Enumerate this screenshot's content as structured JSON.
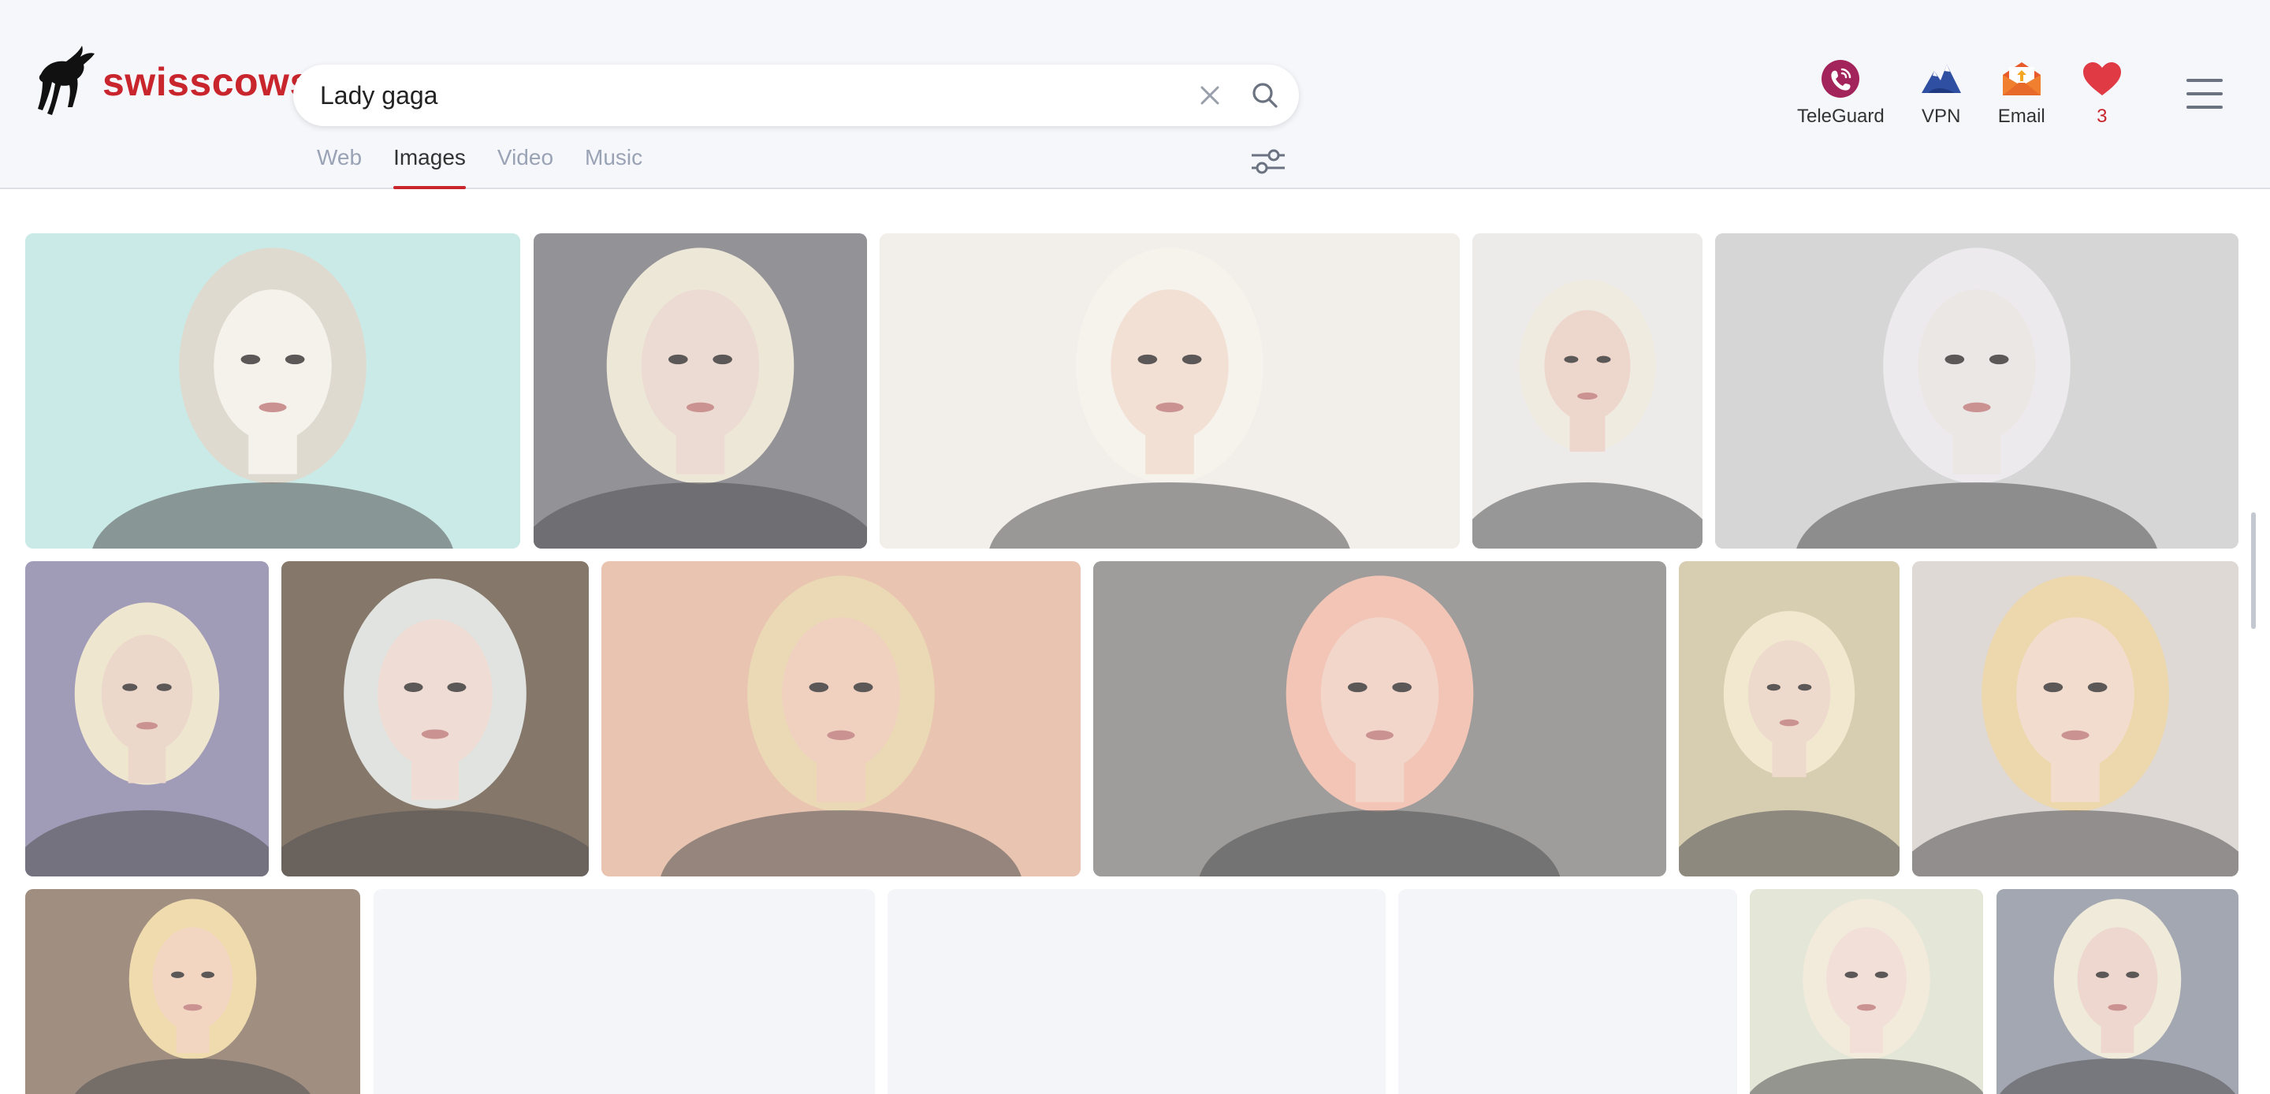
{
  "logo": {
    "text": "swisscows"
  },
  "search": {
    "value": "Lady gaga",
    "placeholder": ""
  },
  "tabs": [
    {
      "label": "Web",
      "active": false
    },
    {
      "label": "Images",
      "active": true
    },
    {
      "label": "Video",
      "active": false
    },
    {
      "label": "Music",
      "active": false
    }
  ],
  "nav": {
    "teleguard": {
      "label": "TeleGuard",
      "icon": "teleguard-icon"
    },
    "vpn": {
      "label": "VPN",
      "icon": "vpn-icon"
    },
    "email": {
      "label": "Email",
      "icon": "email-icon"
    },
    "favorites": {
      "count": "3",
      "icon": "heart-icon"
    }
  },
  "colors": {
    "accent": "#c9252c",
    "header_bg": "#f6f7fb",
    "tab_inactive": "#9aa3b5"
  },
  "images": [
    {
      "name": "image-result-1",
      "bg": "#bfe6e2",
      "fg": "#f3efe8",
      "hair": "#d8d2c6"
    },
    {
      "name": "image-result-2",
      "bg": "#7c7a80",
      "fg": "#e8d4c8",
      "hair": "#eae2cf"
    },
    {
      "name": "image-result-3",
      "bg": "#efece6",
      "fg": "#efd9cc",
      "hair": "#f4f1ea"
    },
    {
      "name": "image-result-4",
      "bg": "#e9e7e6",
      "fg": "#eacfc3",
      "hair": "#ece7da"
    },
    {
      "name": "image-result-5",
      "bg": "#cdcdcf",
      "fg": "#e7e2e0",
      "hair": "#e8e6e8"
    },
    {
      "name": "image-result-6",
      "bg": "#8c86a8",
      "fg": "#e8cfc0",
      "hair": "#ece1c6"
    },
    {
      "name": "image-result-7",
      "bg": "#6b5a4a",
      "fg": "#ecd6cc",
      "hair": "#d9ddd8"
    },
    {
      "name": "image-result-8",
      "bg": "#e3b8a0",
      "fg": "#edc7b1",
      "hair": "#e6d1a4"
    },
    {
      "name": "image-result-9",
      "bg": "#8a8886",
      "fg": "#efcdbf",
      "hair": "#f0b9a6"
    },
    {
      "name": "image-result-10",
      "bg": "#cfc4a2",
      "fg": "#e9d2c2",
      "hair": "#efe3c5"
    },
    {
      "name": "image-result-11",
      "bg": "#d7d1cc",
      "fg": "#efd5c2",
      "hair": "#e9cf9c"
    },
    {
      "name": "image-result-12",
      "bg": "#8c7666",
      "fg": "#efcdb4",
      "hair": "#ecd39c"
    },
    {
      "name": "image-result-13",
      "bg": "#f4f5f8",
      "fg": "#f4f5f8",
      "hair": "#f4f5f8"
    },
    {
      "name": "image-result-14",
      "bg": "#f4f5f8",
      "fg": "#f4f5f8",
      "hair": "#f4f5f8"
    },
    {
      "name": "image-result-15",
      "bg": "#f4f5f8",
      "fg": "#f4f5f8",
      "hair": "#f4f5f8"
    },
    {
      "name": "image-result-16",
      "bg": "#dfe2cf",
      "fg": "#efd8cf",
      "hair": "#efe6d3"
    },
    {
      "name": "image-result-17",
      "bg": "#8f94a0",
      "fg": "#ebcfc4",
      "hair": "#ece6d2"
    }
  ]
}
